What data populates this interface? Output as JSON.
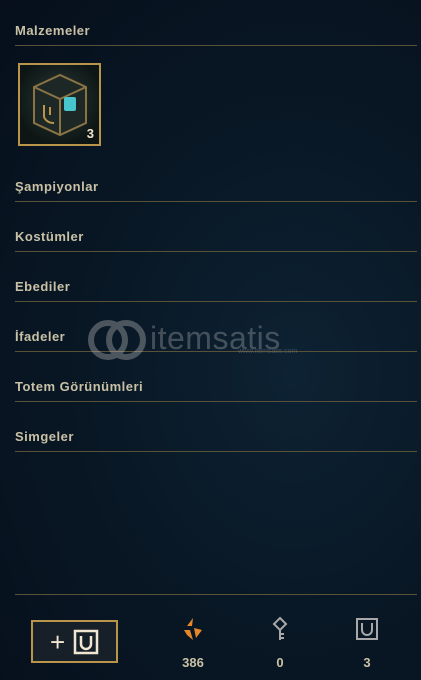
{
  "sections": {
    "materials": "Malzemeler",
    "champions": "Şampiyonlar",
    "skins": "Kostümler",
    "eternals": "Ebediler",
    "emotes": "İfadeler",
    "ward_skins": "Totem Görünümleri",
    "icons": "Simgeler"
  },
  "materials_items": [
    {
      "icon": "hextech-chest-icon",
      "count": "3"
    }
  ],
  "watermark": {
    "brand": "itemsatis",
    "sub": "www.itemsatis.com"
  },
  "footer": {
    "add_button": {
      "icon": "plus-chest-icon"
    },
    "currencies": [
      {
        "icon": "orange-essence-icon",
        "value": "386",
        "color": "#e8862a"
      },
      {
        "icon": "key-icon",
        "value": "0",
        "color": "#a8a8a8"
      },
      {
        "icon": "chest-icon",
        "value": "3",
        "color": "#a8a8a8"
      }
    ]
  }
}
